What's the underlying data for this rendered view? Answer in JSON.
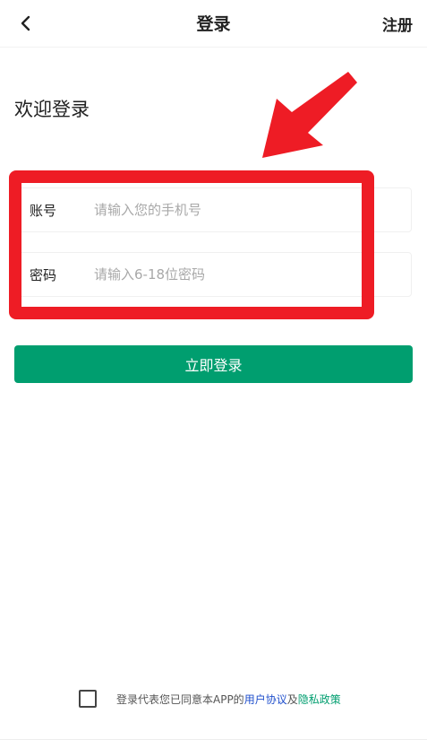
{
  "header": {
    "title": "登录",
    "register_label": "注册",
    "back_icon": "chevron-left-icon"
  },
  "welcome": "欢迎登录",
  "form": {
    "account": {
      "label": "账号",
      "placeholder": "请输入您的手机号",
      "value": ""
    },
    "password": {
      "label": "密码",
      "placeholder": "请输入6-18位密码",
      "value": ""
    },
    "submit_label": "立即登录"
  },
  "agreement": {
    "checked": false,
    "prefix": "登录代表您已同意本APP的",
    "user_agreement": "用户协议",
    "conjunction": "及",
    "privacy_policy": "隐私政策"
  },
  "colors": {
    "primary": "#009e6f",
    "annotation_red": "#ee1c25",
    "link_user": "#1f4fcc",
    "link_privacy": "#009e6f"
  }
}
